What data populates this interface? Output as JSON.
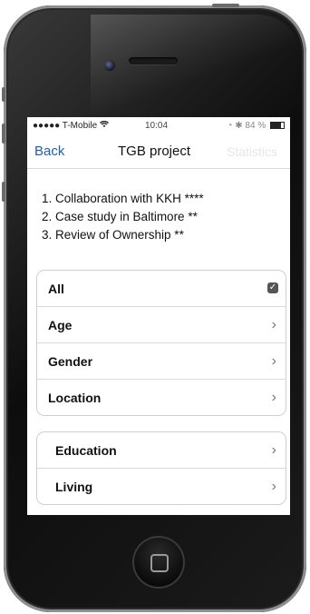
{
  "status_bar": {
    "carrier": "●●●●● T-Mobile",
    "time": "10:04",
    "battery": "84 %"
  },
  "nav": {
    "back_label": "Back",
    "title": "TGB project",
    "right_label": "Statistics"
  },
  "projects": [
    "1. Collaboration with KKH ****",
    "2. Case study in Baltimore **",
    "3. Review of Ownership **"
  ],
  "filters": {
    "group1": [
      {
        "label": "All",
        "control": "checkbox",
        "checked": true
      },
      {
        "label": "Age",
        "control": "chevron"
      },
      {
        "label": "Gender",
        "control": "chevron"
      },
      {
        "label": "Location",
        "control": "chevron"
      }
    ],
    "group2": [
      {
        "label": "Education",
        "control": "chevron"
      },
      {
        "label": "Living",
        "control": "chevron"
      }
    ]
  },
  "icons": {
    "chevron": "›",
    "check": "✓",
    "wifi": "wifi-icon",
    "bluetooth": "bluetooth-icon"
  },
  "colors": {
    "accent": "#1e5faa",
    "phone_body": "#111111"
  }
}
